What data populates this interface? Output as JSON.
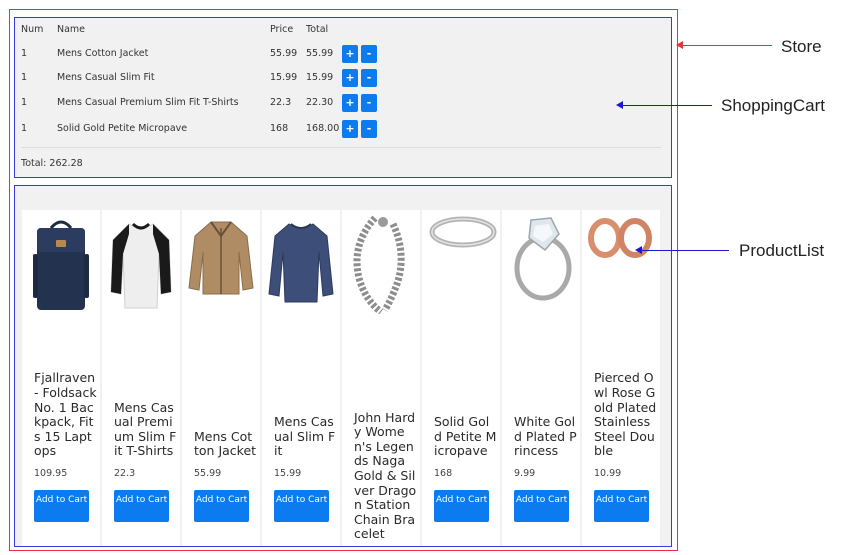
{
  "cart": {
    "headers": {
      "num": "Num",
      "name": "Name",
      "price": "Price",
      "total": "Total"
    },
    "rows": [
      {
        "num": "1",
        "name": "Mens Cotton Jacket",
        "price": "55.99",
        "total": "55.99"
      },
      {
        "num": "1",
        "name": "Mens Casual Slim Fit",
        "price": "15.99",
        "total": "15.99"
      },
      {
        "num": "1",
        "name": "Mens Casual Premium Slim Fit T-Shirts",
        "price": "22.3",
        "total": "22.30"
      },
      {
        "num": "1",
        "name": "Solid Gold Petite Micropave",
        "price": "168",
        "total": "168.00"
      }
    ],
    "plus_label": "+",
    "minus_label": "-",
    "total_label": "Total:",
    "total_value": "262.28"
  },
  "products": [
    {
      "title": "Fjallraven - Foldsack No. 1 Backpack, Fits 15 Laptops",
      "price": "109.95",
      "button": "Add to Cart",
      "image": "backpack-icon"
    },
    {
      "title": "Mens Casual Premium Slim Fit T-Shirts",
      "price": "22.3",
      "button": "Add to Cart",
      "image": "raglan-shirt-icon"
    },
    {
      "title": "Mens Cotton Jacket",
      "price": "55.99",
      "button": "Add to Cart",
      "image": "jacket-icon"
    },
    {
      "title": "Mens Casual Slim Fit",
      "price": "15.99",
      "button": "Add to Cart",
      "image": "longsleeve-shirt-icon"
    },
    {
      "title": "John Hardy Women's Legends Naga Gold & Silver Dragon Station Chain Bracelet",
      "price": "",
      "button": "",
      "image": "chain-bracelet-icon"
    },
    {
      "title": "Solid Gold Petite Micropave",
      "price": "168",
      "button": "Add to Cart",
      "image": "band-ring-icon"
    },
    {
      "title": "White Gold Plated Princess",
      "price": "9.99",
      "button": "Add to Cart",
      "image": "diamond-ring-icon"
    },
    {
      "title": "Pierced Owl Rose Gold Plated Stainless Steel Double",
      "price": "10.99",
      "button": "Add to Cart",
      "image": "rose-gold-plugs-icon"
    }
  ],
  "annotations": {
    "store": "Store",
    "cart": "ShoppingCart",
    "list": "ProductList"
  },
  "colors": {
    "store_border": "#e8313a",
    "component_border": "#3a3ad8",
    "button_blue": "#0d7bf0",
    "panel_bg": "#f1f1f2"
  }
}
